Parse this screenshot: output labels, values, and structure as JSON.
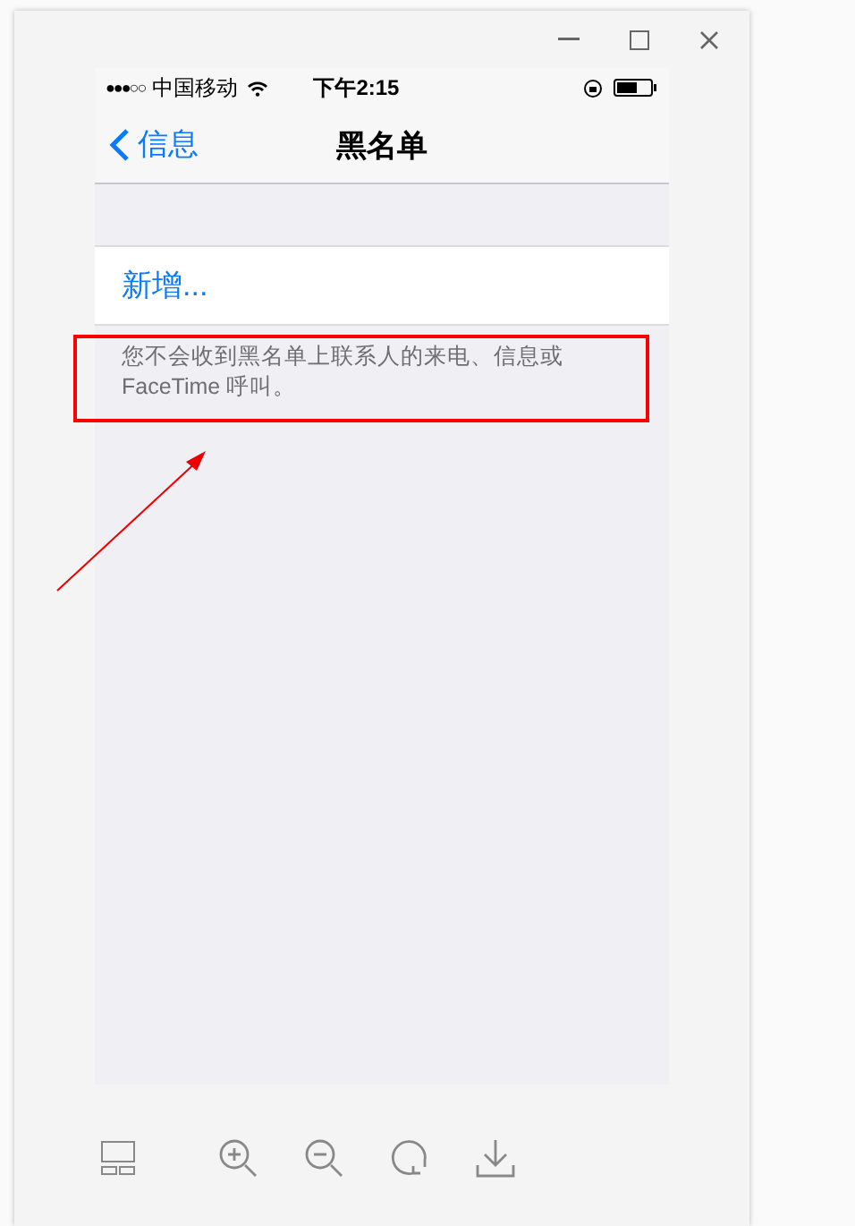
{
  "status_bar": {
    "signal": "●●●○○",
    "carrier": "中国移动",
    "time": "下午2:15"
  },
  "nav": {
    "back": "信息",
    "title": "黑名单"
  },
  "rows": [
    {
      "label": "新增..."
    }
  ],
  "note": "您不会收到黑名单上联系人的来电、信息或FaceTime 呼叫。"
}
